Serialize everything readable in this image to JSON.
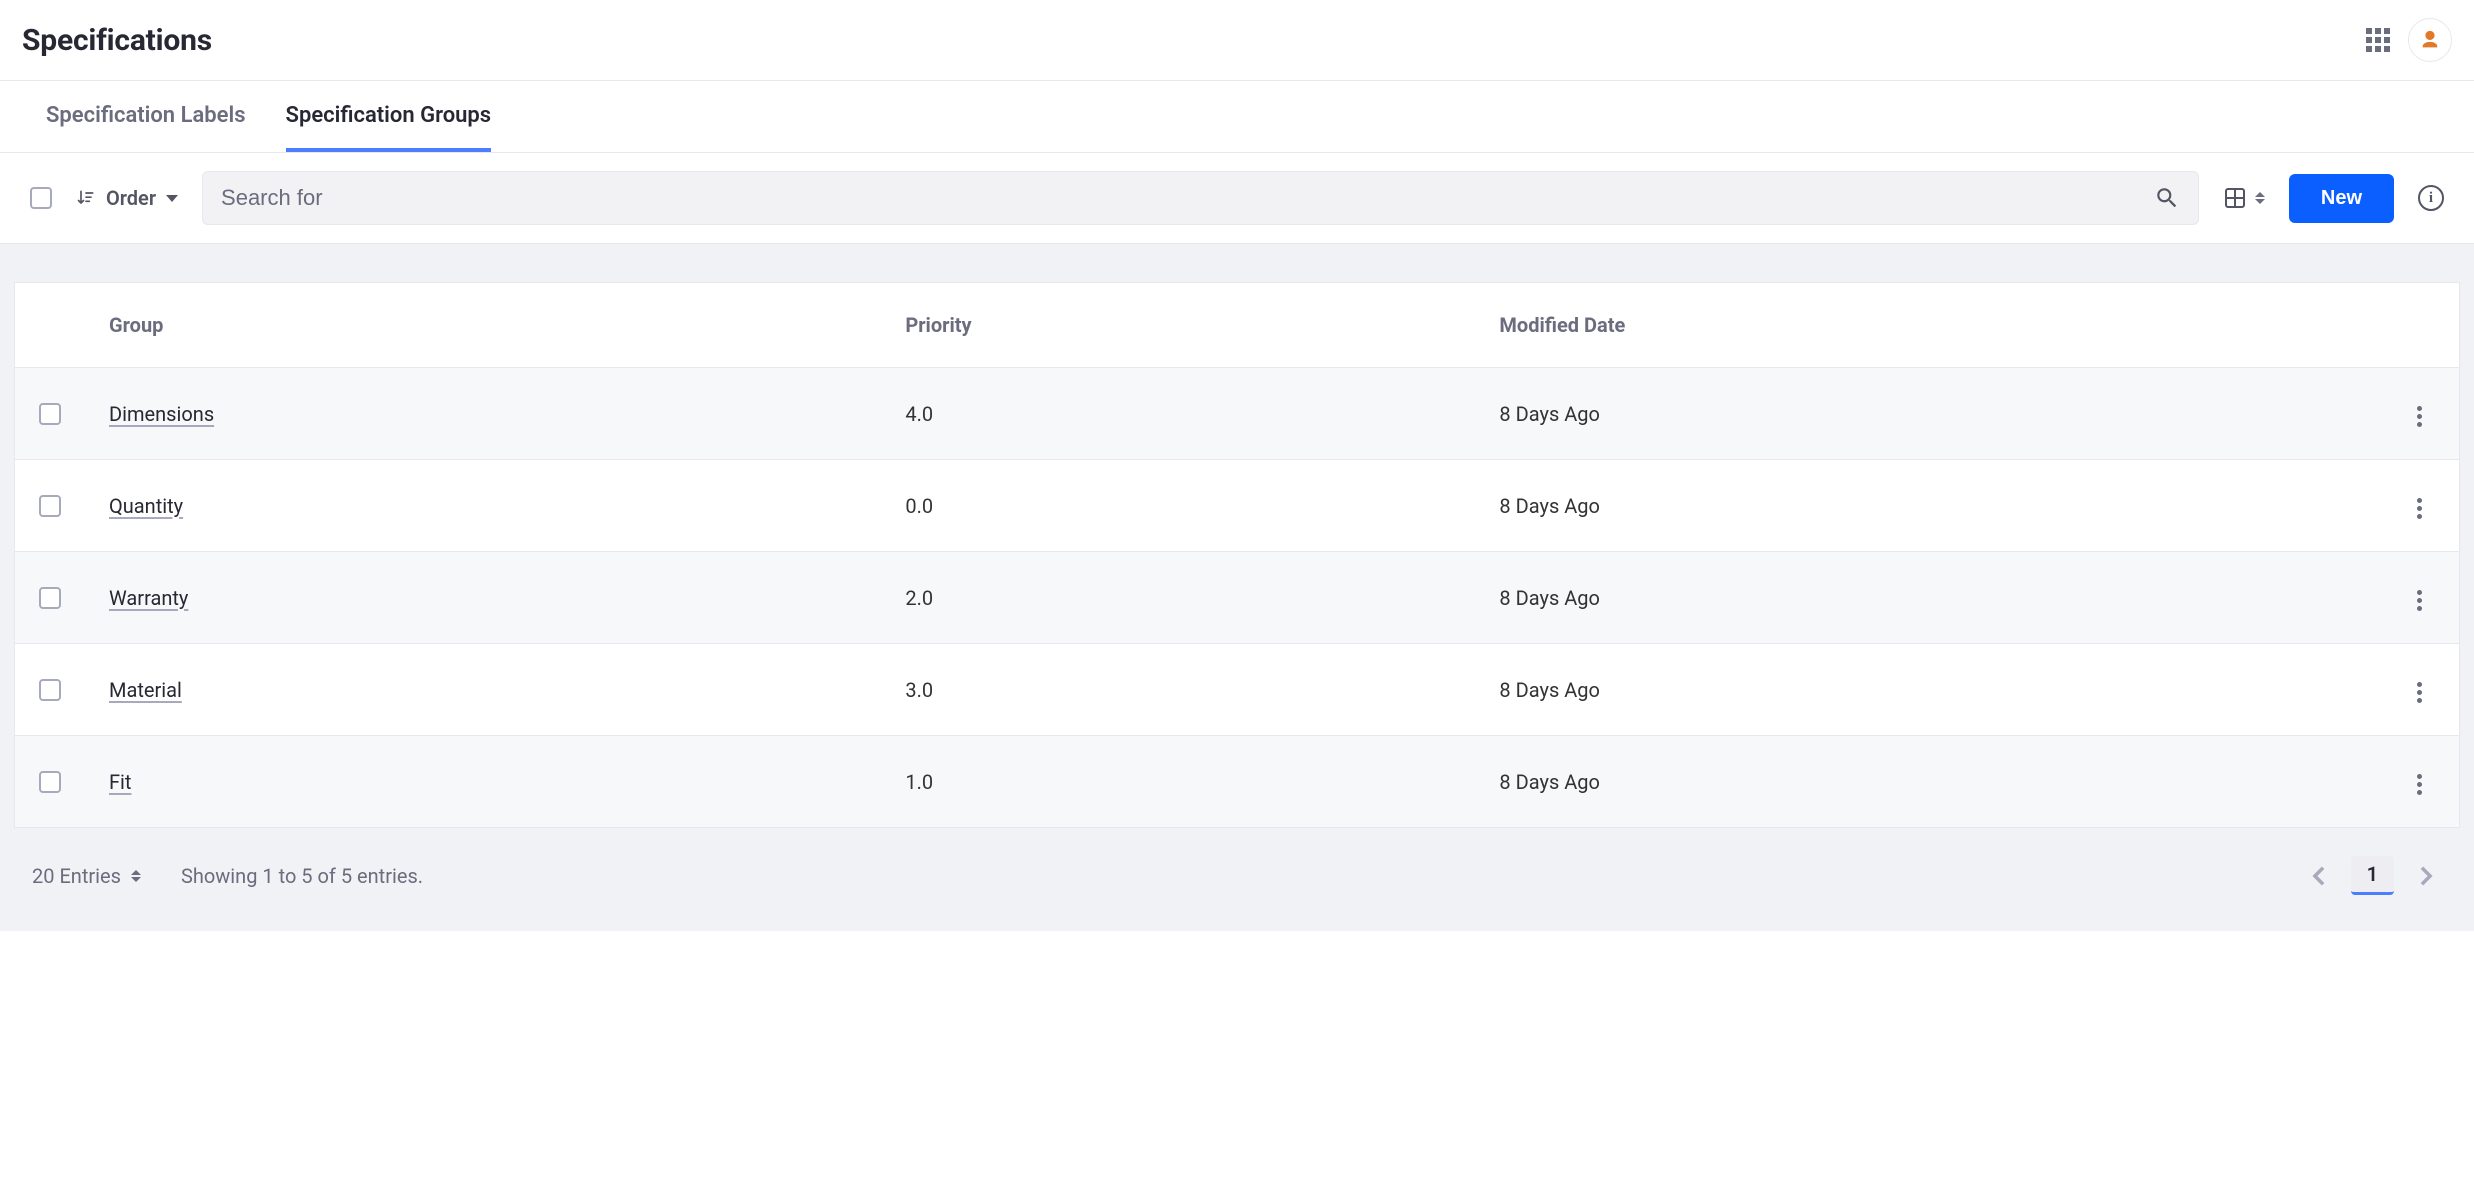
{
  "header": {
    "title": "Specifications"
  },
  "tabs": {
    "items": [
      {
        "label": "Specification Labels",
        "active": false
      },
      {
        "label": "Specification Groups",
        "active": true
      }
    ]
  },
  "toolbar": {
    "order_label": "Order",
    "search_placeholder": "Search for",
    "new_label": "New"
  },
  "table": {
    "columns": {
      "group": "Group",
      "priority": "Priority",
      "modified": "Modified Date"
    },
    "rows": [
      {
        "group": "Dimensions",
        "priority": "4.0",
        "modified": "8 Days Ago"
      },
      {
        "group": "Quantity",
        "priority": "0.0",
        "modified": "8 Days Ago"
      },
      {
        "group": "Warranty",
        "priority": "2.0",
        "modified": "8 Days Ago"
      },
      {
        "group": "Material",
        "priority": "3.0",
        "modified": "8 Days Ago"
      },
      {
        "group": "Fit",
        "priority": "1.0",
        "modified": "8 Days Ago"
      }
    ]
  },
  "footer": {
    "entries_label": "20 Entries",
    "showing_text": "Showing 1 to 5 of 5 entries.",
    "current_page": "1"
  }
}
